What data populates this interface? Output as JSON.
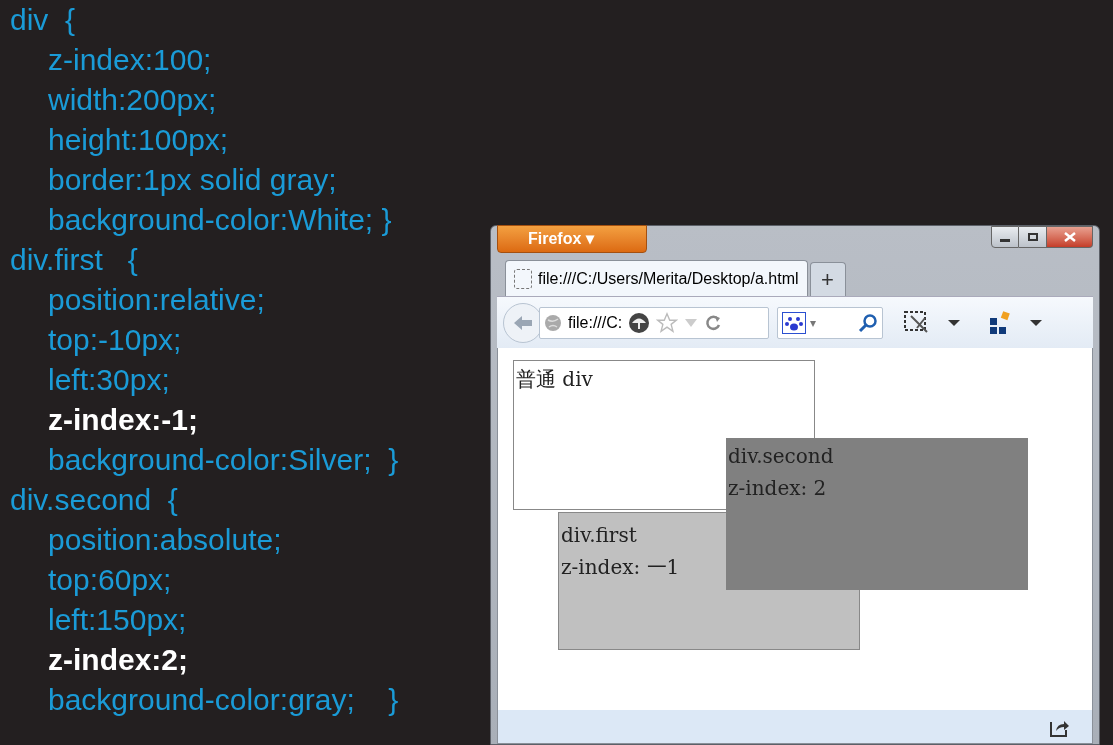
{
  "code_lines": [
    {
      "text": "div  {",
      "kind": "selector"
    },
    {
      "text": "z-index:100;",
      "kind": "property"
    },
    {
      "text": "width:200px;",
      "kind": "property"
    },
    {
      "text": "height:100px;",
      "kind": "property"
    },
    {
      "text": "border:1px solid gray;",
      "kind": "property"
    },
    {
      "text": "background-color:White; }",
      "kind": "property"
    },
    {
      "text": "div.first   {",
      "kind": "selector"
    },
    {
      "text": "position:relative;",
      "kind": "property"
    },
    {
      "text": "top:-10px;",
      "kind": "property"
    },
    {
      "text": "left:30px;",
      "kind": "property"
    },
    {
      "text": "z-index:-1;",
      "kind": "highlight"
    },
    {
      "text": "background-color:Silver;  }",
      "kind": "property"
    },
    {
      "text": "div.second  {",
      "kind": "selector"
    },
    {
      "text": "position:absolute;",
      "kind": "property"
    },
    {
      "text": "top:60px;",
      "kind": "property"
    },
    {
      "text": "left:150px;",
      "kind": "property"
    },
    {
      "text": "z-index:2;",
      "kind": "highlight"
    },
    {
      "text": "background-color:gray;    }",
      "kind": "property"
    }
  ],
  "browser": {
    "menu_button": "Firefox ▾",
    "tabs": [
      {
        "label": "file:///C:/Users/Merita/Desktop/a.html",
        "selected": true
      }
    ],
    "new_tab": "+",
    "address": "file:///C:",
    "search_engine_caret": "▾",
    "page": {
      "plain_div": [
        "普通 div"
      ],
      "first_div": [
        "div.first",
        "z-index: 一1"
      ],
      "second_div": [
        "div.second",
        "z-index:  2"
      ]
    }
  }
}
